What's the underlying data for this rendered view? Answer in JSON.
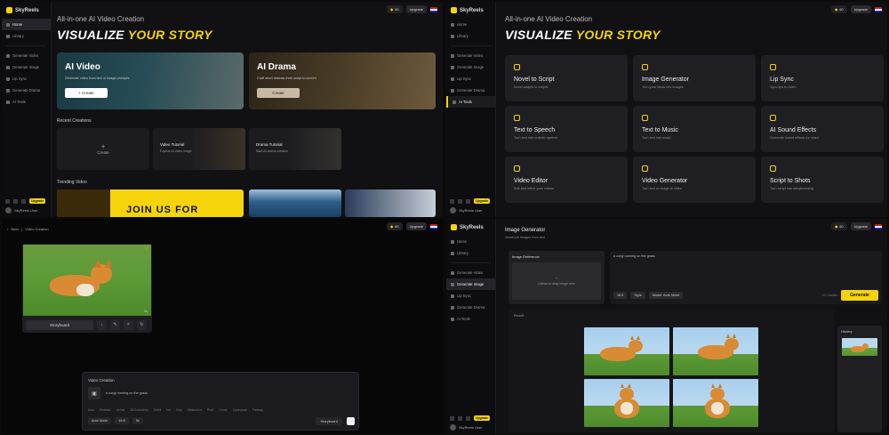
{
  "app": {
    "name": "SkyReels"
  },
  "header": {
    "credits": "60",
    "upgrade_label": "Upgrade"
  },
  "sidebar": {
    "items": [
      "Home",
      "Library",
      "Generate Video",
      "Generate Image",
      "Lip Sync",
      "Generate Drama",
      "AI Tools"
    ],
    "pro_label": "Upgrade",
    "user_label": "SkyReels User"
  },
  "home": {
    "hero_sub": "All-in-one AI Video Creation",
    "hero_title_main": "VISUALIZE ",
    "hero_title_accent": "YOUR STORY",
    "cards": [
      {
        "title": "AI Video",
        "desc": "Generate video from text or image prompts",
        "button": "+ Create"
      },
      {
        "title": "AI Drama",
        "desc": "Craft short dramas from script to screen",
        "button": "Create"
      }
    ],
    "recent_title": "Recent Creations",
    "recent_create": "Create",
    "recent": [
      {
        "title": "Video Tutorial",
        "sub": "Explore AI video magic"
      },
      {
        "title": "Drama Tutorial",
        "sub": "Start AI drama creation"
      }
    ],
    "trending_title": "Trending Video",
    "trending_banner": "JOIN US FOR"
  },
  "tools": {
    "hero_sub": "All-in-one AI Video Creation",
    "hero_title_main": "VISUALIZE ",
    "hero_title_accent": "YOUR STORY",
    "items": [
      {
        "title": "Novel to Script",
        "desc": "Novel adapts to scripts",
        "icon": "document-icon"
      },
      {
        "title": "Image Generator",
        "desc": "Turn your ideas into images",
        "icon": "image-icon"
      },
      {
        "title": "Lip Sync",
        "desc": "Sync lips to video",
        "icon": "face-icon"
      },
      {
        "title": "Text to Speech",
        "desc": "Turn text into realistic speech",
        "icon": "speech-icon"
      },
      {
        "title": "Text to Music",
        "desc": "Turn text into music",
        "icon": "music-icon"
      },
      {
        "title": "AI Sound Effects",
        "desc": "Generate sound effects for video",
        "icon": "bell-icon"
      },
      {
        "title": "Video Editor",
        "desc": "Edit and refine your videos",
        "icon": "edit-icon"
      },
      {
        "title": "Video Generator",
        "desc": "Turn text or image to video",
        "icon": "play-icon"
      },
      {
        "title": "Script to Shots",
        "desc": "Turn script into storyboarding",
        "icon": "shots-icon"
      }
    ]
  },
  "storyboard": {
    "back": "Back",
    "title": "Video Creation",
    "card_button": "Storyboard",
    "panel_title": "Video Creation",
    "prompt": "a corgi running on the grass",
    "styles": [
      "Auto",
      "Realistic",
      "Anime",
      "3D Animation",
      "Ghibli",
      "Ink",
      "Clay",
      "Watercolor",
      "Pixel",
      "Comic",
      "Cyberpunk",
      "Fantasy"
    ],
    "mode": "Auto Mode",
    "ratio": "16:9",
    "count": "5s",
    "submit": "Storyboard"
  },
  "imagegen": {
    "title": "Image Generator",
    "subtitle": "Generate images from text",
    "reference_title": "Image Reference",
    "reference_hint": "Upload or drag image here",
    "prompt": "a corgi running on the grass",
    "ratio": "16:9",
    "style": "Style",
    "model": "Model: Auto Mode",
    "credits": "10 Credits",
    "generate": "Generate",
    "results_label": "Result",
    "history_label": "History"
  }
}
